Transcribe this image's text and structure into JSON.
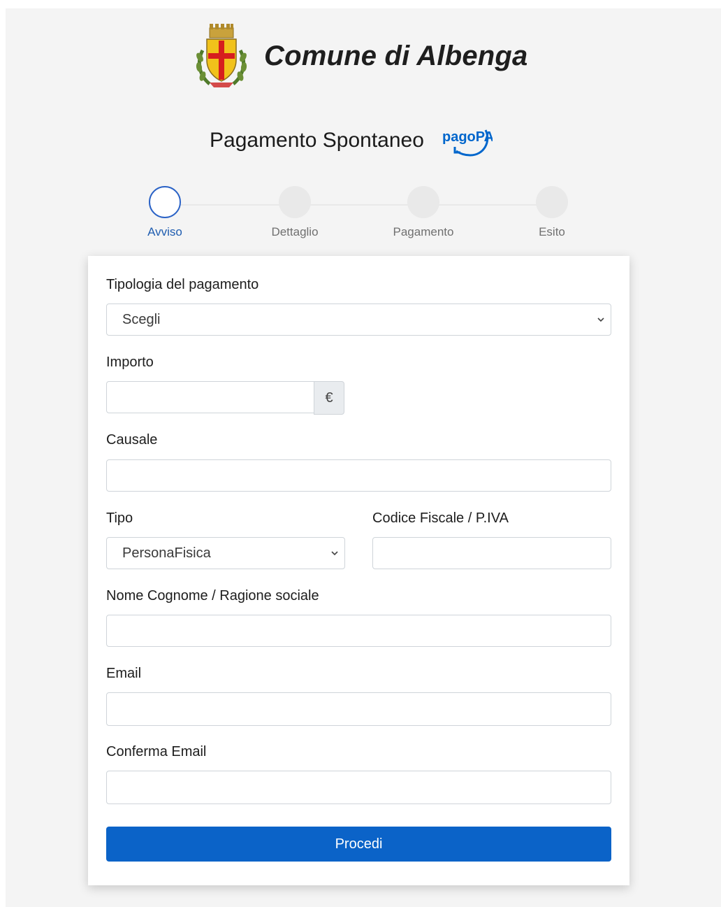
{
  "header": {
    "municipality_name": "Comune di Albenga",
    "page_title": "Pagamento Spontaneo",
    "pagopa_logo_text": "pagoPA"
  },
  "stepper": {
    "steps": [
      {
        "label": "Avviso",
        "active": true
      },
      {
        "label": "Dettaglio",
        "active": false
      },
      {
        "label": "Pagamento",
        "active": false
      },
      {
        "label": "Esito",
        "active": false
      }
    ]
  },
  "form": {
    "payment_type": {
      "label": "Tipologia del pagamento",
      "selected": "Scegli"
    },
    "amount": {
      "label": "Importo",
      "value": "",
      "currency_symbol": "€"
    },
    "reason": {
      "label": "Causale",
      "value": ""
    },
    "subject_type": {
      "label": "Tipo",
      "selected": "PersonaFisica"
    },
    "tax_code": {
      "label": "Codice Fiscale / P.IVA",
      "value": ""
    },
    "name": {
      "label": "Nome Cognome / Ragione sociale",
      "value": ""
    },
    "email": {
      "label": "Email",
      "value": ""
    },
    "email_confirm": {
      "label": "Conferma Email",
      "value": ""
    },
    "submit_label": "Procedi"
  },
  "colors": {
    "primary": "#0b63c8",
    "step_active": "#2a62c6",
    "pagopa_blue": "#0066cc"
  }
}
